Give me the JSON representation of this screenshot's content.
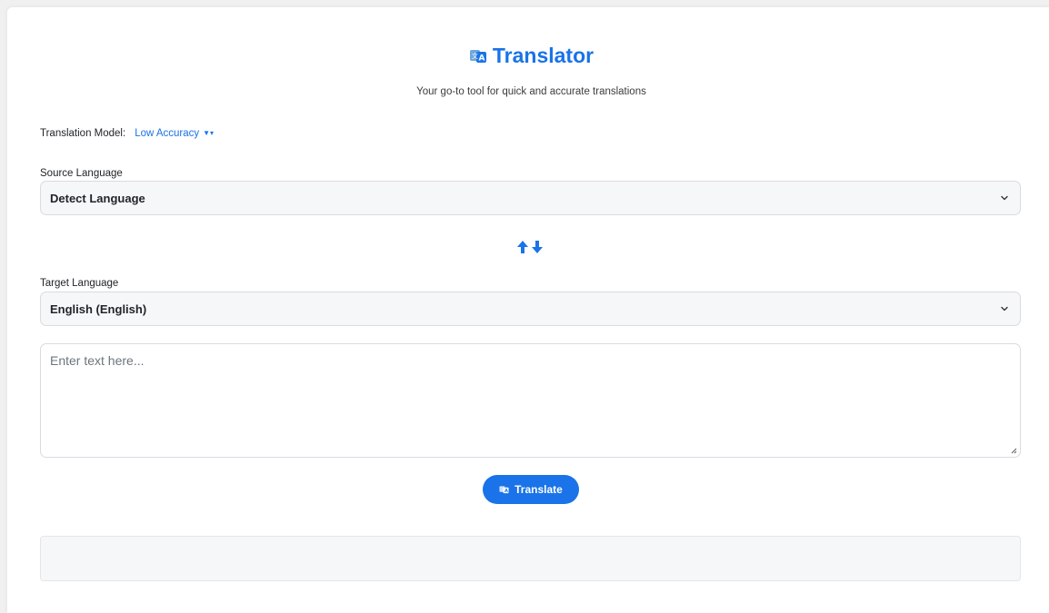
{
  "header": {
    "title": "Translator",
    "subtitle": "Your go-to tool for quick and accurate translations",
    "icon": "translate-icon"
  },
  "model": {
    "label": "Translation Model:",
    "selected": "Low Accuracy"
  },
  "source": {
    "label": "Source Language",
    "selected": "Detect Language"
  },
  "swap": {
    "icon": "swap-arrows-icon"
  },
  "target": {
    "label": "Target Language",
    "selected": "English (English)"
  },
  "input": {
    "placeholder": "Enter text here...",
    "value": ""
  },
  "actions": {
    "translate_label": "Translate"
  },
  "output": {
    "text": ""
  },
  "colors": {
    "accent": "#1a73e8",
    "field_bg": "#f6f7f9",
    "border": "#d8dbe0"
  }
}
